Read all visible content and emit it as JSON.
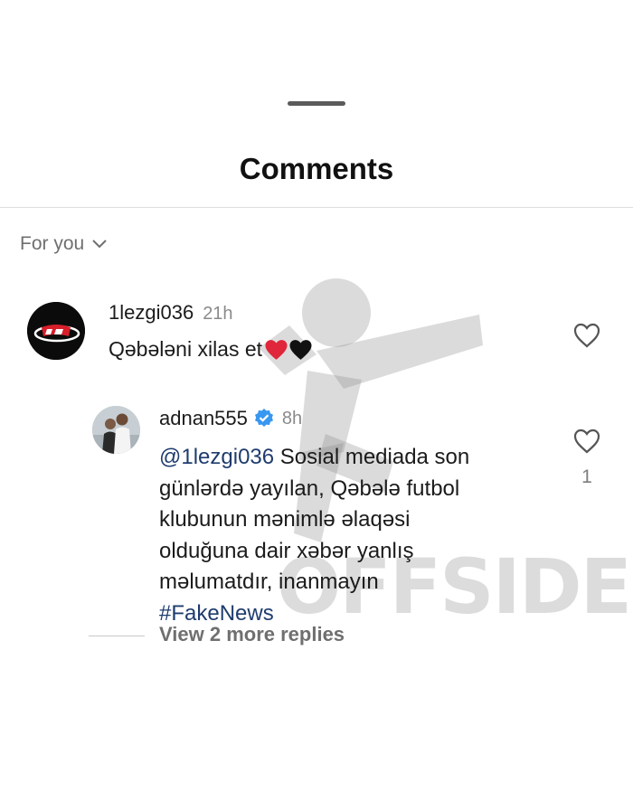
{
  "sheet": {
    "title": "Comments",
    "filter_label": "For you"
  },
  "comments": [
    {
      "username": "1lezgi036",
      "time": "21h",
      "text": "Qəbələni xilas et",
      "emojis": [
        "red-heart",
        "black-heart"
      ],
      "avatar_icon": "team-logo-avatar"
    }
  ],
  "reply": {
    "username": "adnan555",
    "verified": true,
    "time": "8h",
    "mention": "@1lezgi036",
    "lines": [
      " Sosial mediada son",
      "günlərdə yayılan, Qəbələ futbol",
      "klubunun mənimlə əlaqəsi",
      "olduğuna dair xəbər yanlış",
      "məlumatdır, inanmayın"
    ],
    "hashtag": "#FakeNews",
    "like_count": "1",
    "avatar_icon": "user-photo-avatar"
  },
  "view_more_replies": "View 2 more replies",
  "watermark": "OFFSIDE",
  "colors": {
    "link": "#1f3c6e",
    "verified": "#3897f0",
    "muted": "#8a8a8a",
    "heart_red": "#e0263a"
  }
}
